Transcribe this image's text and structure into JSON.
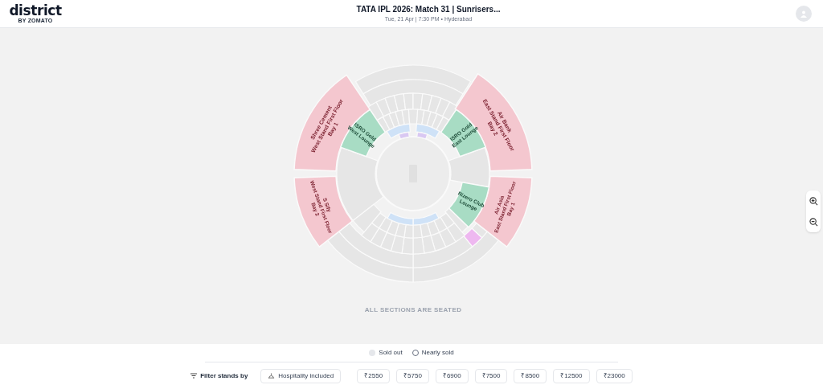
{
  "header": {
    "logo": "district",
    "logo_sub": "BY ZOMATO",
    "title": "TATA IPL 2026: Match 31 | Sunrisers...",
    "subtitle": "Tue, 21 Apr | 7:30 PM • Hyderabad"
  },
  "stands": [
    {
      "lines": [
        "Air Bank",
        "East Stand First Floor",
        "Bay 2"
      ],
      "color": "#f4c7cf"
    },
    {
      "lines": [
        "Air Asia",
        "East Stand First Floor",
        "Bay 1"
      ],
      "color": "#f4c7cf"
    },
    {
      "lines": [
        "S Sify",
        "West Stand First Floor",
        "Bay 2"
      ],
      "color": "#f4c7cf"
    },
    {
      "lines": [
        "Shree Cement",
        "West Stand First Floor",
        "Bay 1"
      ],
      "color": "#f4c7cf"
    },
    {
      "lines": [
        "ISRO Gold",
        "West Lounge"
      ],
      "color": "#a8dcc4"
    },
    {
      "lines": [
        "ISRO Gold",
        "East Lounge"
      ],
      "color": "#a8dcc4"
    },
    {
      "lines": [
        "Rizero Club",
        "Lounge"
      ],
      "color": "#a8dcc4"
    }
  ],
  "note": "ALL SECTIONS ARE SEATED",
  "legend": [
    {
      "label": "Sold out",
      "kind": "dot"
    },
    {
      "label": "Nearly sold",
      "kind": "outline"
    }
  ],
  "filter": {
    "label": "Filter stands by",
    "chips": [
      {
        "label": "Hospitality included",
        "kind": "hospitality",
        "selected": false
      },
      {
        "label": "₹2550",
        "kind": "price",
        "selected": false
      },
      {
        "label": "₹5750",
        "kind": "price",
        "selected": false
      },
      {
        "label": "₹6900",
        "kind": "price",
        "selected": false
      },
      {
        "label": "₹7500",
        "kind": "price",
        "selected": false
      },
      {
        "label": "₹8500",
        "kind": "price",
        "selected": false
      },
      {
        "label": "₹12500",
        "kind": "price",
        "selected": false
      },
      {
        "label": "₹23000",
        "kind": "price",
        "selected": false
      }
    ]
  }
}
